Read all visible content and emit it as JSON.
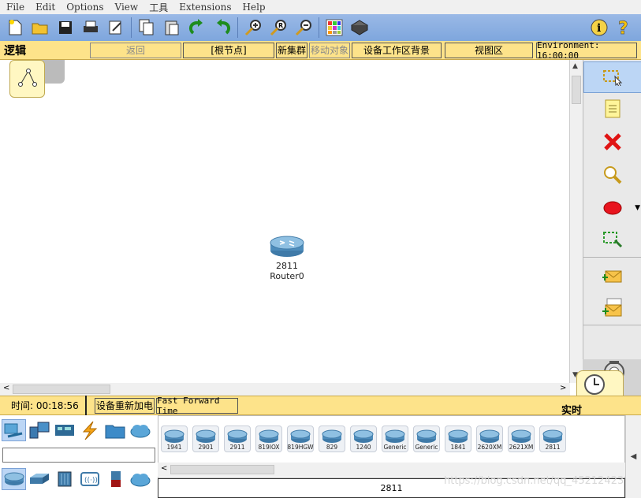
{
  "menu": [
    "File",
    "Edit",
    "Options",
    "View",
    "工具",
    "Extensions",
    "Help"
  ],
  "pathbar": {
    "mode": "逻辑",
    "back": "返回",
    "root": "[根节点]",
    "new_cluster": "新集群",
    "move_object": "移动对象",
    "background": "设备工作区背景",
    "viewport": "视图区",
    "environment": "Environment: 16:00:00"
  },
  "workspace": {
    "device_model": "2811",
    "device_name": "Router0"
  },
  "timebar": {
    "time": "时间: 00:18:56",
    "power_cycle": "设备重新加电",
    "fast_forward": "Fast Forward Time",
    "realtime": "实时"
  },
  "devices": [
    "1941",
    "2901",
    "2911",
    "819IOX",
    "819HGW",
    "829",
    "1240",
    "Generic",
    "Generic",
    "1841",
    "2620XM",
    "2621XM",
    "2811"
  ],
  "selected_device": "2811",
  "watermark": "https://blog.csdn.net/qq_45212423"
}
